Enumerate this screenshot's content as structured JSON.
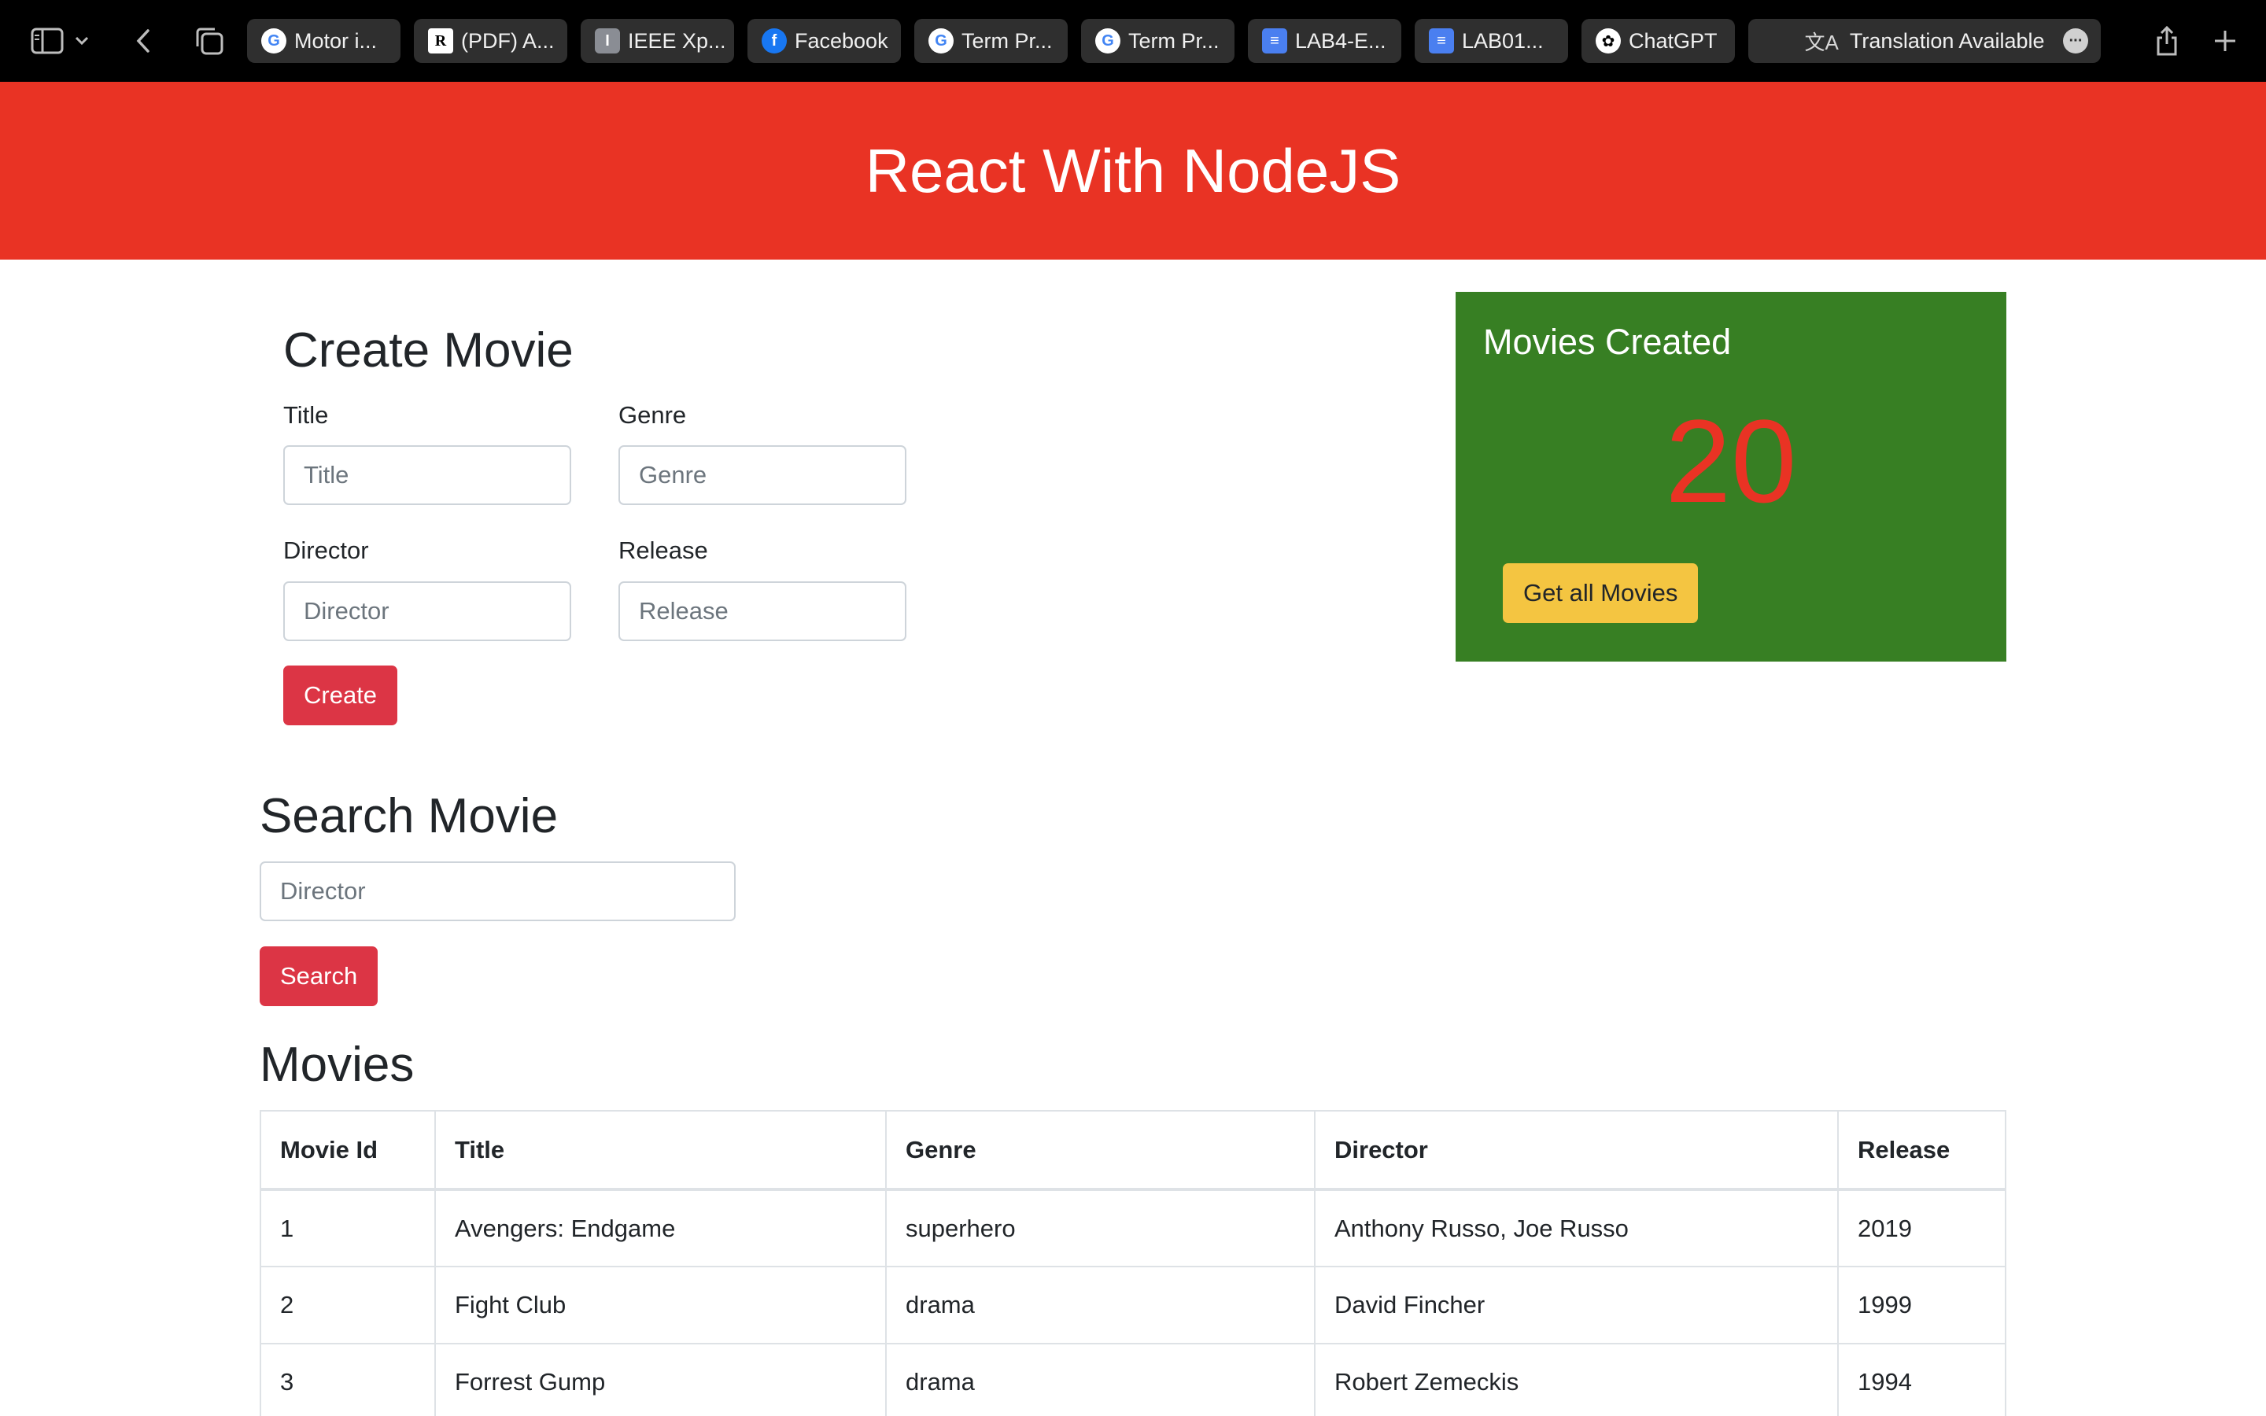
{
  "browser": {
    "tabs": [
      {
        "label": "Motor i...",
        "icon": "google-icon"
      },
      {
        "label": "(PDF) A...",
        "icon": "researchgate-icon"
      },
      {
        "label": "IEEE Xp...",
        "icon": "ieee-icon"
      },
      {
        "label": "Facebook",
        "icon": "facebook-icon"
      },
      {
        "label": "Term Pr...",
        "icon": "google-icon"
      },
      {
        "label": "Term Pr...",
        "icon": "google-icon"
      },
      {
        "label": "LAB4-E...",
        "icon": "docs-icon"
      },
      {
        "label": "LAB01...",
        "icon": "docs-icon"
      },
      {
        "label": "ChatGPT",
        "icon": "chatgpt-icon"
      }
    ],
    "translation_label": "Translation Available"
  },
  "header": {
    "title": "React With NodeJS",
    "color": "#e93324"
  },
  "create": {
    "heading": "Create Movie",
    "title_label": "Title",
    "title_placeholder": "Title",
    "genre_label": "Genre",
    "genre_placeholder": "Genre",
    "director_label": "Director",
    "director_placeholder": "Director",
    "release_label": "Release",
    "release_placeholder": "Release",
    "button": "Create"
  },
  "stats": {
    "heading": "Movies Created",
    "count": "20",
    "button": "Get all Movies",
    "card_color": "#377f23",
    "button_color": "#f4c541"
  },
  "search": {
    "heading": "Search Movie",
    "placeholder": "Director",
    "button": "Search"
  },
  "movies": {
    "heading": "Movies",
    "columns": [
      "Movie Id",
      "Title",
      "Genre",
      "Director",
      "Release"
    ],
    "rows": [
      [
        "1",
        "Avengers: Endgame",
        "superhero",
        "Anthony Russo, Joe Russo",
        "2019"
      ],
      [
        "2",
        "Fight Club",
        "drama",
        "David Fincher",
        "1999"
      ],
      [
        "3",
        "Forrest Gump",
        "drama",
        "Robert Zemeckis",
        "1994"
      ]
    ]
  }
}
